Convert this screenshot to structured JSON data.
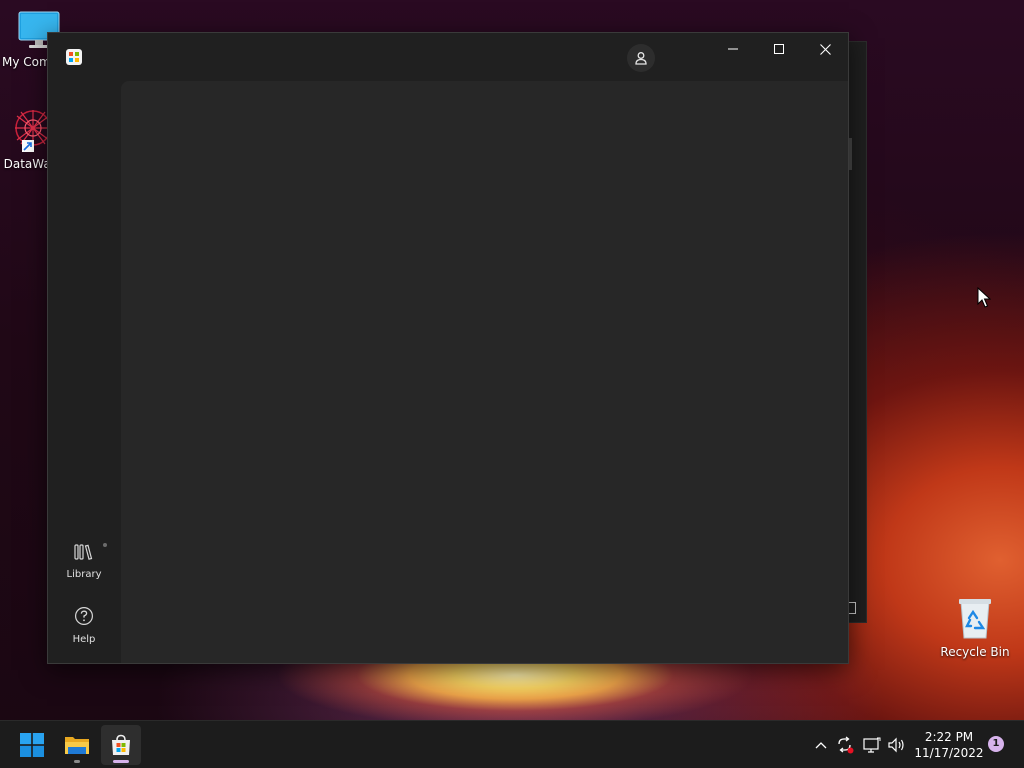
{
  "desktop": {
    "icons": [
      {
        "label": "My Computer",
        "icon": "monitor-icon"
      },
      {
        "label": "DataWag",
        "icon": "datawag-app-icon"
      },
      {
        "label": "Recycle Bin",
        "icon": "recycle-bin-icon"
      }
    ]
  },
  "store_window": {
    "app_icon": "microsoft-store-icon",
    "account_icon": "person-icon",
    "nav": [
      {
        "label": "Library",
        "icon": "library-icon"
      },
      {
        "label": "Help",
        "icon": "help-icon"
      }
    ],
    "controls": {
      "minimize": "minimize-icon",
      "maximize": "maximize-icon",
      "close": "close-icon"
    }
  },
  "taskbar": {
    "pinned": [
      {
        "name": "Start",
        "icon": "windows-start-icon"
      },
      {
        "name": "File Explorer",
        "icon": "folder-icon"
      },
      {
        "name": "Microsoft Store",
        "icon": "microsoft-store-icon"
      }
    ],
    "tray": [
      "chevron-up-icon",
      "sync-icon",
      "network-icon",
      "volume-icon"
    ],
    "clock": {
      "time": "2:22 PM",
      "date": "11/17/2022"
    },
    "notifications": "1"
  },
  "colors": {
    "window_bg": "#202020",
    "content_bg": "#272727",
    "taskbar_bg": "#1c1c1c",
    "accent": "#0078d4"
  }
}
